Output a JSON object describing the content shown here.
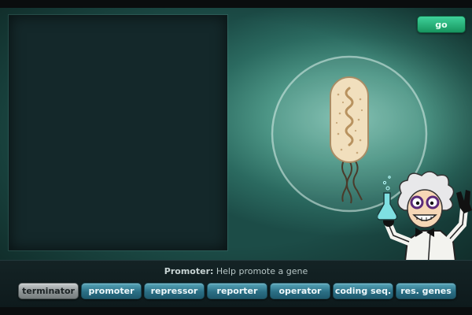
{
  "go_label": "go",
  "info": {
    "name": "Promoter:",
    "description": "Help promote a gene"
  },
  "toolbar": {
    "buttons": [
      {
        "label": "terminator",
        "active": true
      },
      {
        "label": "promoter",
        "active": false
      },
      {
        "label": "repressor",
        "active": false
      },
      {
        "label": "reporter",
        "active": false
      },
      {
        "label": "operator",
        "active": false
      },
      {
        "label": "coding seq.",
        "active": false
      },
      {
        "label": "res. genes",
        "active": false
      }
    ]
  },
  "colors": {
    "accent_go": "#2bb77c",
    "button_blue": "#3a8aa0",
    "button_active_gray": "#9aa0a1",
    "workspace_bg": "#14282a"
  },
  "icons": [
    "bacterium-cell-icon",
    "mad-scientist-icon"
  ]
}
